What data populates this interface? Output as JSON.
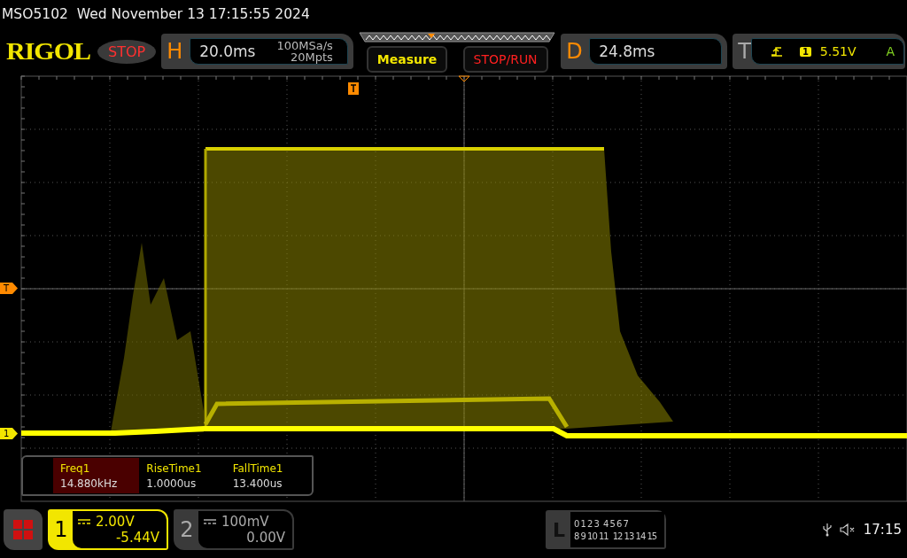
{
  "header": {
    "model": "MSO5102",
    "datetime": "Wed November 13 17:15:55 2024"
  },
  "toolbar": {
    "logo": "RIGOL",
    "run_state": {
      "label": "STOP",
      "kind": "stopped"
    },
    "horizontal": {
      "letter": "H",
      "timebase": "20.0ms",
      "sample_rate": "100MSa/s",
      "memory_depth": "20Mpts"
    },
    "buttons": [
      "Measure",
      "STOP/RUN"
    ],
    "delay": {
      "letter": "D",
      "value": "24.8ms"
    },
    "trigger": {
      "letter": "T",
      "source": "1",
      "level": "5.51V",
      "mode": "A"
    }
  },
  "screen": {
    "markers": [
      {
        "label": "T",
        "kind": "trigger"
      },
      {
        "label": "1",
        "kind": "channel"
      }
    ],
    "measurements": [
      {
        "name": "Freq1",
        "value": "14.880kHz",
        "selected": true
      },
      {
        "name": "RiseTime1",
        "value": "1.0000us",
        "selected": false
      },
      {
        "name": "FallTime1",
        "value": "13.400us",
        "selected": false
      }
    ]
  },
  "footer": {
    "channels": [
      {
        "number": "1",
        "scale": "2.00V",
        "offset": "-5.44V",
        "active": true
      },
      {
        "number": "2",
        "scale": "100mV",
        "offset": "0.00V",
        "active": false
      }
    ],
    "logic": {
      "letter": "L",
      "rows": [
        [
          "0 1 2 3",
          "4 5 6 7"
        ],
        [
          "8 9 10 11",
          "12 13 14 15"
        ]
      ]
    },
    "time": "17:15"
  }
}
